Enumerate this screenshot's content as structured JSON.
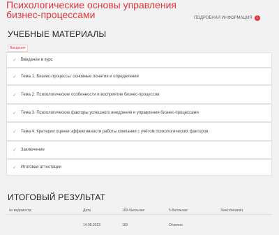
{
  "course": {
    "title": "Психологические основы управления бизнес-процессами",
    "details_label": "ПОДРОБНАЯ ИНФОРМАЦИЯ",
    "info_icon": "i"
  },
  "materials": {
    "section_title": "УЧЕБНЫЕ МАТЕРИАЛЫ",
    "tag": "Введение",
    "items": [
      {
        "label": "Введение в курс"
      },
      {
        "label": "Тема 1. Бизнес-процессы: основные понятия и определения"
      },
      {
        "label": "Тема 2. Психологические особенности и восприятие бизнес-процессов"
      },
      {
        "label": "Тема 3. Психологические факторы успешного внедрения и управления бизнес-процессами"
      },
      {
        "label": "Тема 4. Критерии оценки эффективности работы компании с учётом психологических факторов"
      },
      {
        "label": "Заключение"
      },
      {
        "label": "Итоговая аттестация"
      }
    ]
  },
  "result": {
    "section_title": "ИТОГОВЫЙ РЕЗУЛЬТАТ",
    "headers": [
      "№ ведомости",
      "Дата",
      "100-балльная",
      "5-балльная",
      "Зачёт/незачёт"
    ],
    "row": [
      "",
      "14.08.2023",
      "100",
      "Отлично",
      ""
    ]
  }
}
